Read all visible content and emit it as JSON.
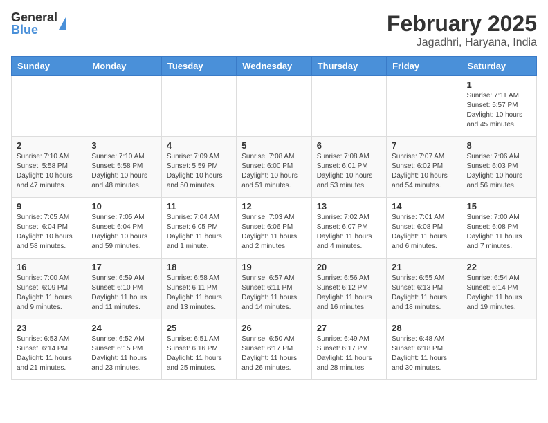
{
  "header": {
    "logo_general": "General",
    "logo_blue": "Blue",
    "month_title": "February 2025",
    "location": "Jagadhri, Haryana, India"
  },
  "weekdays": [
    "Sunday",
    "Monday",
    "Tuesday",
    "Wednesday",
    "Thursday",
    "Friday",
    "Saturday"
  ],
  "weeks": [
    [
      {
        "day": "",
        "info": ""
      },
      {
        "day": "",
        "info": ""
      },
      {
        "day": "",
        "info": ""
      },
      {
        "day": "",
        "info": ""
      },
      {
        "day": "",
        "info": ""
      },
      {
        "day": "",
        "info": ""
      },
      {
        "day": "1",
        "info": "Sunrise: 7:11 AM\nSunset: 5:57 PM\nDaylight: 10 hours\nand 45 minutes."
      }
    ],
    [
      {
        "day": "2",
        "info": "Sunrise: 7:10 AM\nSunset: 5:58 PM\nDaylight: 10 hours\nand 47 minutes."
      },
      {
        "day": "3",
        "info": "Sunrise: 7:10 AM\nSunset: 5:58 PM\nDaylight: 10 hours\nand 48 minutes."
      },
      {
        "day": "4",
        "info": "Sunrise: 7:09 AM\nSunset: 5:59 PM\nDaylight: 10 hours\nand 50 minutes."
      },
      {
        "day": "5",
        "info": "Sunrise: 7:08 AM\nSunset: 6:00 PM\nDaylight: 10 hours\nand 51 minutes."
      },
      {
        "day": "6",
        "info": "Sunrise: 7:08 AM\nSunset: 6:01 PM\nDaylight: 10 hours\nand 53 minutes."
      },
      {
        "day": "7",
        "info": "Sunrise: 7:07 AM\nSunset: 6:02 PM\nDaylight: 10 hours\nand 54 minutes."
      },
      {
        "day": "8",
        "info": "Sunrise: 7:06 AM\nSunset: 6:03 PM\nDaylight: 10 hours\nand 56 minutes."
      }
    ],
    [
      {
        "day": "9",
        "info": "Sunrise: 7:05 AM\nSunset: 6:04 PM\nDaylight: 10 hours\nand 58 minutes."
      },
      {
        "day": "10",
        "info": "Sunrise: 7:05 AM\nSunset: 6:04 PM\nDaylight: 10 hours\nand 59 minutes."
      },
      {
        "day": "11",
        "info": "Sunrise: 7:04 AM\nSunset: 6:05 PM\nDaylight: 11 hours\nand 1 minute."
      },
      {
        "day": "12",
        "info": "Sunrise: 7:03 AM\nSunset: 6:06 PM\nDaylight: 11 hours\nand 2 minutes."
      },
      {
        "day": "13",
        "info": "Sunrise: 7:02 AM\nSunset: 6:07 PM\nDaylight: 11 hours\nand 4 minutes."
      },
      {
        "day": "14",
        "info": "Sunrise: 7:01 AM\nSunset: 6:08 PM\nDaylight: 11 hours\nand 6 minutes."
      },
      {
        "day": "15",
        "info": "Sunrise: 7:00 AM\nSunset: 6:08 PM\nDaylight: 11 hours\nand 7 minutes."
      }
    ],
    [
      {
        "day": "16",
        "info": "Sunrise: 7:00 AM\nSunset: 6:09 PM\nDaylight: 11 hours\nand 9 minutes."
      },
      {
        "day": "17",
        "info": "Sunrise: 6:59 AM\nSunset: 6:10 PM\nDaylight: 11 hours\nand 11 minutes."
      },
      {
        "day": "18",
        "info": "Sunrise: 6:58 AM\nSunset: 6:11 PM\nDaylight: 11 hours\nand 13 minutes."
      },
      {
        "day": "19",
        "info": "Sunrise: 6:57 AM\nSunset: 6:11 PM\nDaylight: 11 hours\nand 14 minutes."
      },
      {
        "day": "20",
        "info": "Sunrise: 6:56 AM\nSunset: 6:12 PM\nDaylight: 11 hours\nand 16 minutes."
      },
      {
        "day": "21",
        "info": "Sunrise: 6:55 AM\nSunset: 6:13 PM\nDaylight: 11 hours\nand 18 minutes."
      },
      {
        "day": "22",
        "info": "Sunrise: 6:54 AM\nSunset: 6:14 PM\nDaylight: 11 hours\nand 19 minutes."
      }
    ],
    [
      {
        "day": "23",
        "info": "Sunrise: 6:53 AM\nSunset: 6:14 PM\nDaylight: 11 hours\nand 21 minutes."
      },
      {
        "day": "24",
        "info": "Sunrise: 6:52 AM\nSunset: 6:15 PM\nDaylight: 11 hours\nand 23 minutes."
      },
      {
        "day": "25",
        "info": "Sunrise: 6:51 AM\nSunset: 6:16 PM\nDaylight: 11 hours\nand 25 minutes."
      },
      {
        "day": "26",
        "info": "Sunrise: 6:50 AM\nSunset: 6:17 PM\nDaylight: 11 hours\nand 26 minutes."
      },
      {
        "day": "27",
        "info": "Sunrise: 6:49 AM\nSunset: 6:17 PM\nDaylight: 11 hours\nand 28 minutes."
      },
      {
        "day": "28",
        "info": "Sunrise: 6:48 AM\nSunset: 6:18 PM\nDaylight: 11 hours\nand 30 minutes."
      },
      {
        "day": "",
        "info": ""
      }
    ]
  ]
}
